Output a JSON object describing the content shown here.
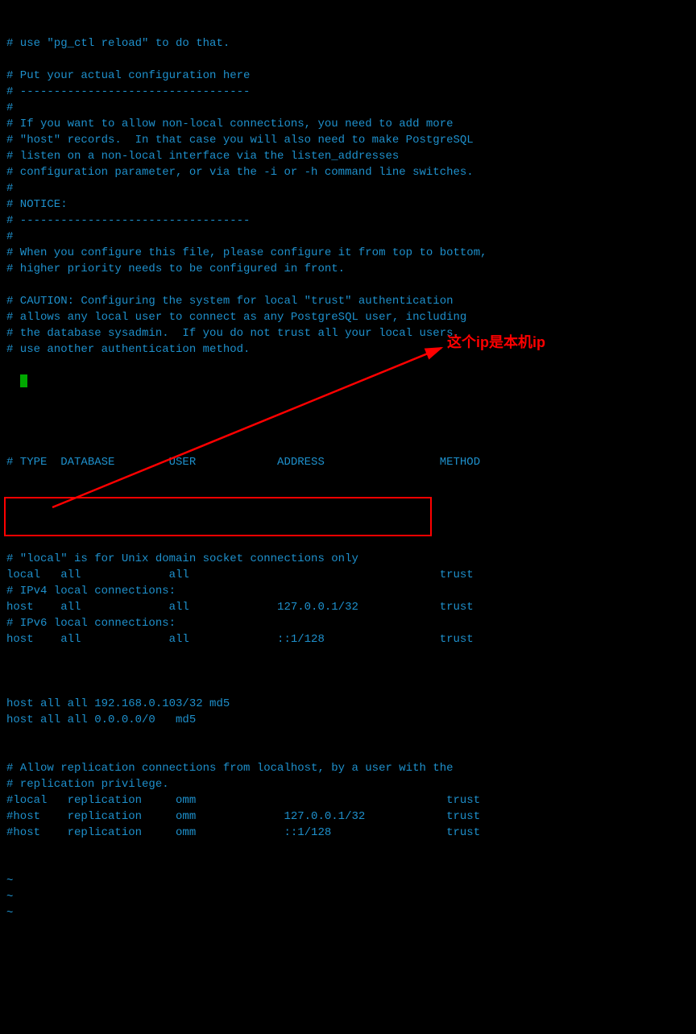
{
  "config_lines": [
    "# use \"pg_ctl reload\" to do that.",
    "",
    "# Put your actual configuration here",
    "# ----------------------------------",
    "#",
    "# If you want to allow non-local connections, you need to add more",
    "# \"host\" records.  In that case you will also need to make PostgreSQL",
    "# listen on a non-local interface via the listen_addresses",
    "# configuration parameter, or via the -i or -h command line switches.",
    "#",
    "# NOTICE:",
    "# ----------------------------------",
    "#",
    "# When you configure this file, please configure it from top to bottom,",
    "# higher priority needs to be configured in front.",
    "",
    "# CAUTION: Configuring the system for local \"trust\" authentication",
    "# allows any local user to connect as any PostgreSQL user, including",
    "# the database sysadmin.  If you do not trust all your local users,",
    "# use another authentication method."
  ],
  "header_line": "# TYPE  DATABASE        USER            ADDRESS                 METHOD",
  "body_lines_1": [
    "# \"local\" is for Unix domain socket connections only",
    "local   all             all                                     trust",
    "# IPv4 local connections:",
    "host    all             all             127.0.0.1/32            trust",
    "# IPv6 local connections:",
    "host    all             all             ::1/128                 trust",
    ""
  ],
  "highlighted_lines": [
    "host all all 192.168.0.103/32 md5",
    "host all all 0.0.0.0/0   md5"
  ],
  "body_lines_2": [
    "# Allow replication connections from localhost, by a user with the",
    "# replication privilege.",
    "#local   replication     omm                                     trust",
    "#host    replication     omm             127.0.0.1/32            trust",
    "#host    replication     omm             ::1/128                 trust"
  ],
  "tilde_lines": [
    "~",
    "~",
    "~"
  ],
  "annotation_text": "这个ip是本机ip"
}
